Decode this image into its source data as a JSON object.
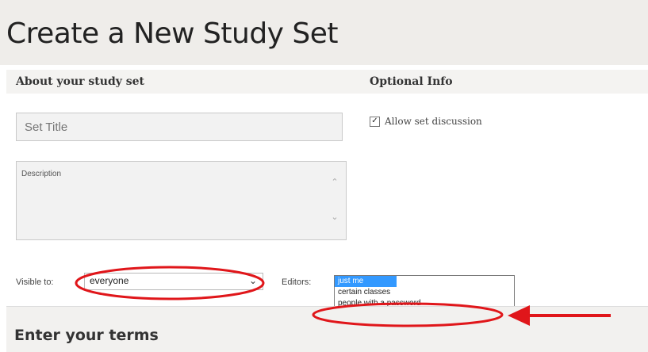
{
  "page": {
    "title": "Create a New Study Set"
  },
  "about": {
    "heading": "About your study set",
    "title_placeholder": "Set Title",
    "description_placeholder": "Description"
  },
  "optional": {
    "heading": "Optional Info",
    "allow_discussion_label": "Allow set discussion",
    "allow_discussion_checked": true
  },
  "visibility": {
    "label": "Visible to:",
    "selected": "everyone"
  },
  "editors": {
    "label": "Editors:",
    "options": [
      "just me",
      "certain classes",
      "people with a password"
    ],
    "selected_index": 0
  },
  "terms": {
    "heading": "Enter your terms"
  },
  "annotations": {
    "color": "#e0161a"
  }
}
